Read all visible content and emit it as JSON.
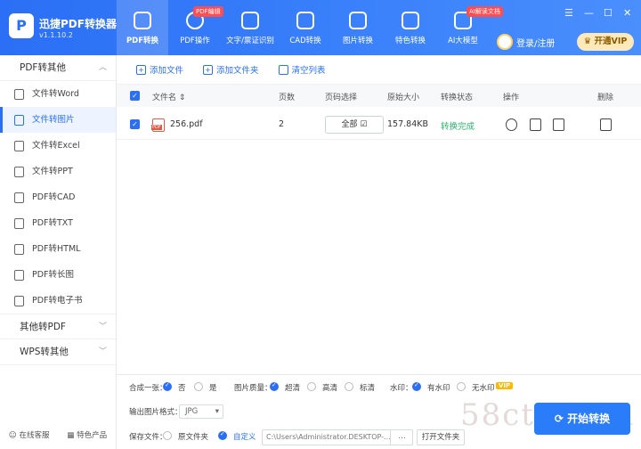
{
  "header": {
    "app_name": "迅捷PDF转换器",
    "version": "v1.1.10.2",
    "logo_letter": "P",
    "tabs": [
      {
        "label": "PDF转换",
        "active": true,
        "badge": ""
      },
      {
        "label": "PDF操作",
        "active": false,
        "badge": "PDF编辑"
      },
      {
        "label": "文字/票证识别",
        "active": false,
        "badge": ""
      },
      {
        "label": "CAD转换",
        "active": false,
        "badge": ""
      },
      {
        "label": "图片转换",
        "active": false,
        "badge": ""
      },
      {
        "label": "特色转换",
        "active": false,
        "badge": ""
      },
      {
        "label": "AI大模型",
        "active": false,
        "badge": "AI解读文档"
      }
    ],
    "login_label": "登录/注册",
    "vip_label": "开通VIP",
    "window_controls": [
      "☰",
      "—",
      "☐",
      "✕"
    ]
  },
  "sidebar": {
    "groups": [
      {
        "label": "PDF转其他",
        "chevron": "︿",
        "items": [
          {
            "label": "文件转Word",
            "active": false
          },
          {
            "label": "文件转图片",
            "active": true
          },
          {
            "label": "文件转Excel",
            "active": false
          },
          {
            "label": "文件转PPT",
            "active": false
          },
          {
            "label": "PDF转CAD",
            "active": false
          },
          {
            "label": "PDF转TXT",
            "active": false
          },
          {
            "label": "PDF转HTML",
            "active": false
          },
          {
            "label": "PDF转长图",
            "active": false
          },
          {
            "label": "PDF转电子书",
            "active": false
          }
        ]
      },
      {
        "label": "其他转PDF",
        "chevron": "﹀",
        "items": []
      },
      {
        "label": "WPS转其他",
        "chevron": "﹀",
        "items": []
      }
    ],
    "footer": {
      "support": "在线客服",
      "products": "特色产品"
    }
  },
  "toolbar": {
    "add_file": "添加文件",
    "add_folder": "添加文件夹",
    "clear_list": "清空列表"
  },
  "table": {
    "headers": {
      "name": "文件名 ⇕",
      "pages": "页数",
      "range": "页码选择",
      "size": "原始大小",
      "status": "转换状态",
      "ops": "操作",
      "delete": "删除"
    },
    "rows": [
      {
        "name": "256.pdf",
        "pages": "2",
        "range": "全部 ☑",
        "size": "157.84KB",
        "status": "转换完成"
      }
    ]
  },
  "options": {
    "merge_label": "合成一张：",
    "merge_no": "否",
    "merge_yes": "是",
    "quality_label": "图片质量：",
    "quality_ultra": "超清",
    "quality_high": "高清",
    "quality_std": "标清",
    "watermark_label": "水印：",
    "watermark_yes": "有水印",
    "watermark_no": "无水印",
    "vip_tag": "VIP",
    "format_label": "输出图片格式：",
    "format_value": "JPG",
    "save_label": "保存文件：",
    "save_source": "原文件夹",
    "save_custom": "自定义",
    "path_value": "C:\\Users\\Administrator.DESKTOP-...",
    "browse_label": "…",
    "open_folder": "打开文件夹"
  },
  "convert_button": "开始转换",
  "watermark_text": "58cto.com",
  "colors": {
    "accent": "#2a6ff5",
    "success": "#2db36b",
    "vip": "#ffb800"
  }
}
